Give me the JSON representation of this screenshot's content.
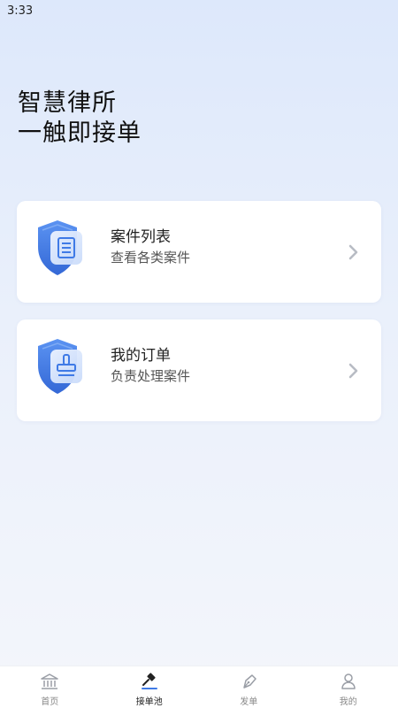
{
  "status_bar": {
    "time": "3:33"
  },
  "hero": {
    "line1": "智慧律所",
    "line2": "一触即接单"
  },
  "cards": [
    {
      "title": "案件列表",
      "subtitle": "查看各类案件",
      "icon": "document-shield-icon"
    },
    {
      "title": "我的订单",
      "subtitle": "负责处理案件",
      "icon": "stamp-shield-icon"
    }
  ],
  "tabs": [
    {
      "label": "首页",
      "icon": "home-building-icon",
      "active": false
    },
    {
      "label": "接单池",
      "icon": "gavel-icon",
      "active": true
    },
    {
      "label": "发单",
      "icon": "pen-nib-icon",
      "active": false
    },
    {
      "label": "我的",
      "icon": "user-icon",
      "active": false
    }
  ],
  "colors": {
    "accent": "#3f7ae6",
    "background_top": "#dde8fb",
    "card": "#ffffff"
  }
}
